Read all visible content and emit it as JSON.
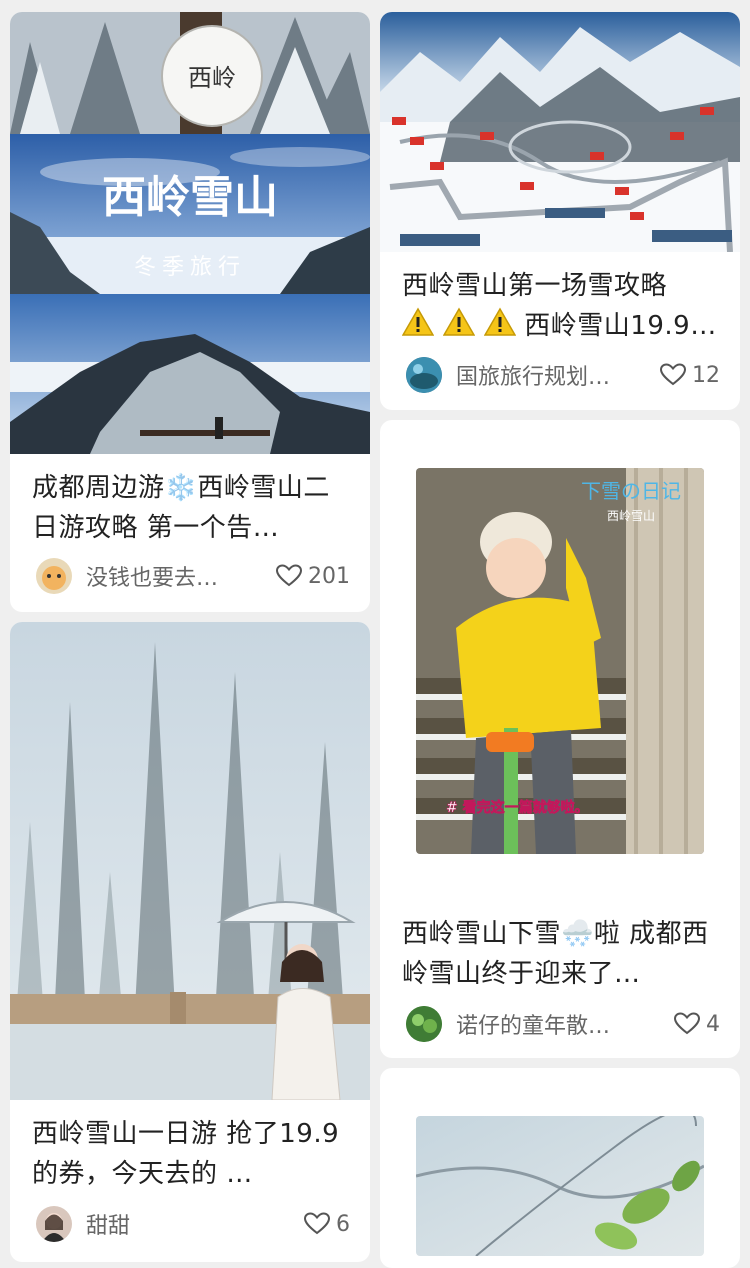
{
  "feed": {
    "cards": [
      {
        "title": "成都周边游❄️西岭雪山二日游攻略 第一个告…",
        "author": "没钱也要去…",
        "likes": "201",
        "image": {
          "sign_text": "西岭",
          "banner_title": "西岭雪山",
          "banner_subtitle": "冬季旅行"
        }
      },
      {
        "title_prefix": "西岭雪山第一场雪攻略",
        "title_line2": "西岭雪山19.9…",
        "author": "国旅旅行规划…",
        "likes": "12"
      },
      {
        "title": "西岭雪山下雪🌨️啦 成都西岭雪山终于迎来了…",
        "author": "诺仔的童年散…",
        "likes": "4",
        "image": {
          "overlay_title": "下雪の日记",
          "overlay_sub": "西岭雪山",
          "caption": "# 看完这一篇就够啦。"
        }
      },
      {
        "title": "西岭雪山一日游 抢了19.9的券，今天去的 …",
        "author": "甜甜",
        "likes": "6"
      }
    ]
  }
}
